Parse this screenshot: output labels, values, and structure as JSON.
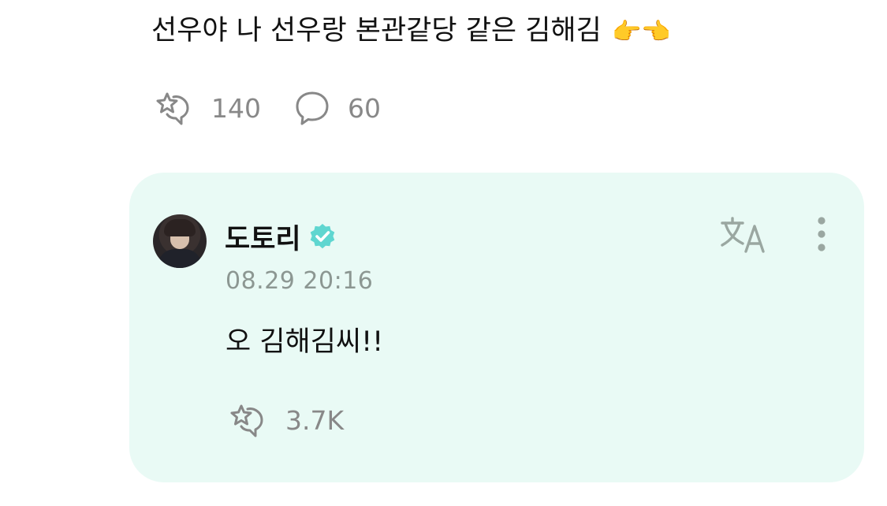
{
  "post": {
    "text": "선우야 나 선우랑 본관같당 같은 김해김",
    "emoji": "👉👈",
    "like_count": "140",
    "comment_count": "60"
  },
  "reply": {
    "author": "도토리",
    "timestamp": "08.29 20:16",
    "text": "오 김해김씨!!",
    "like_count": "3.7K"
  },
  "icons": {
    "like": "star-bubble-icon",
    "comment": "speech-bubble-icon",
    "verified": "verified-badge-icon",
    "translate": "translate-icon",
    "more": "more-vertical-icon"
  },
  "colors": {
    "card_background": "#e9faf5",
    "verified": "#5fd6d0",
    "muted": "#888888",
    "icon_gray": "#9aa7a1"
  }
}
